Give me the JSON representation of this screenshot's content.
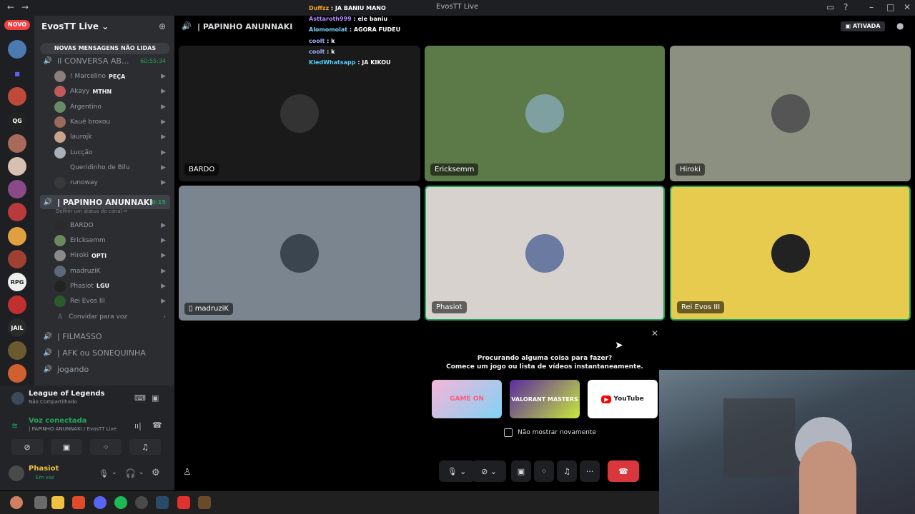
{
  "window": {
    "title": "EvosTT Live",
    "back": "←",
    "forward": "→"
  },
  "server": {
    "name": "EvosTT Live",
    "novo_badge": "NOVO",
    "unread_banner": "NOVAS MENSAGENS NÃO LIDAS"
  },
  "channels_top": {
    "name": "II CONVERSA AB...",
    "timer": "60:55:34"
  },
  "voice_users_1": [
    {
      "name": "! Marcelino",
      "tag": "PEÇA",
      "color": "#8a7f7a"
    },
    {
      "name": "Akayy",
      "tag": "MTHN",
      "color": "#c05a5a"
    },
    {
      "name": "Argentino",
      "tag": "",
      "color": "#6a8a6a"
    },
    {
      "name": "Kauê broxou",
      "tag": "",
      "color": "#9a6a5a"
    },
    {
      "name": "laurojk",
      "tag": "",
      "color": "#c8a48a"
    },
    {
      "name": "Lucção",
      "tag": "",
      "color": "#aab0b8"
    },
    {
      "name": "Queridinho de Bilu",
      "tag": "",
      "color": "#2b2d31"
    },
    {
      "name": "runoway",
      "tag": "",
      "color": "#3a3a3a"
    }
  ],
  "active_channel": {
    "name": "| PAPINHO ANUNNAKI",
    "timer": "0:15",
    "status": "Definir um status do canal ✏"
  },
  "voice_users_2": [
    {
      "name": "BARDO",
      "tag": "",
      "color": "#2b2b2b"
    },
    {
      "name": "Ericksemm",
      "tag": "",
      "color": "#6a8a5a"
    },
    {
      "name": "Hiroki",
      "tag": "OPTI",
      "color": "#8a8a8a"
    },
    {
      "name": "madruziK",
      "tag": "",
      "color": "#5a6a7a"
    },
    {
      "name": "Phasiot",
      "tag": "LGU",
      "color": "#222"
    },
    {
      "name": "Rei Evos III",
      "tag": "",
      "color": "#2b5a2b"
    }
  ],
  "invite_label": "Convidar para voz",
  "other_channels": [
    "| FILMASSO",
    "| AFK ou SONEQUINHA",
    "jogando"
  ],
  "activity_status": {
    "game": "League of Legends",
    "share": "Não Compartilhado"
  },
  "voice_status": {
    "label": "Voz conectada",
    "channel": "| PAPINHO ANUNNAKI / EvosTT Live"
  },
  "user": {
    "name": "Phasiot",
    "status": "Em voz"
  },
  "main_header": {
    "channel": "| PAPINHO ANUNNAKI",
    "active_badge": "ATIVADA"
  },
  "chat_overlay": [
    {
      "user": "Duffzz",
      "msg": "JA BANIU MANO",
      "color": "#f5a623"
    },
    {
      "user": "Asttaroth999",
      "msg": "ele baniu",
      "color": "#b38bff"
    },
    {
      "user": "Alomomolat",
      "msg": "AGORA FUDEU",
      "color": "#7ad3ff"
    },
    {
      "user": "coolt",
      "msg": "k",
      "color": "#9fb0ff"
    },
    {
      "user": "coolt",
      "msg": "k",
      "color": "#9fb0ff"
    },
    {
      "user": "KledWhatsapp",
      "msg": "JA KIKOU",
      "color": "#54d0ff"
    }
  ],
  "tiles": [
    {
      "name": "BARDO",
      "bg": "#1a1a1a",
      "av": "#333"
    },
    {
      "name": "Ericksemm",
      "bg": "#5b7a48",
      "av": "#7fa0a0"
    },
    {
      "name": "Hiroki",
      "bg": "#8c9080",
      "av": "#555"
    },
    {
      "name": "madruziK",
      "bg": "#7b858f",
      "av": "#3a4550"
    },
    {
      "name": "Phasiot",
      "bg": "#d8d2cf",
      "av": "#6a7aa0"
    },
    {
      "name": "Rei Evos III",
      "bg": "#e6cb4f",
      "av": "#222"
    }
  ],
  "activity_prompt": {
    "line1": "Procurando alguma coisa para fazer?",
    "line2": "Comece um jogo ou lista de vídeos instantaneamente.",
    "dont_show": "Não mostrar novamente",
    "cards": [
      "GAME ON",
      "VALORANT MASTERS",
      "YouTube"
    ]
  }
}
